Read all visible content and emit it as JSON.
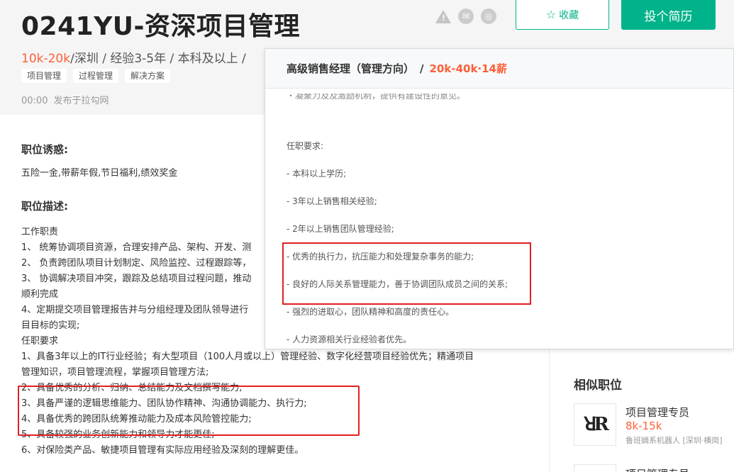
{
  "job": {
    "title": "0241YU-资深项目管理",
    "salary": "10k-20k",
    "meta": "/深圳 / 经验3-5年 / 本科及以上 /",
    "tags": [
      "项目管理",
      "过程管理",
      "解决方案"
    ],
    "publish_time": "00:00",
    "publish_source": "发布于拉勾网"
  },
  "actions": {
    "collect_label": "收藏",
    "apply_label": "投个简历"
  },
  "icons": [
    "warning-icon",
    "wechat-icon",
    "weibo-icon",
    "star-icon"
  ],
  "content": {
    "benefit_title": "职位诱惑:",
    "benefit_text": "五险一金,带薪年假,节日福利,绩效奖金",
    "desc_title": "职位描述:",
    "desc_lines": [
      "工作职责",
      "1、 统筹协调项目资源，合理安排产品、架构、开发、测",
      "2、 负责跨团队项目计划制定、风险监控、过程跟踪等，",
      "3、 协调解决项目冲突，跟踪及总结项目过程问题，推动",
      "顺利完成",
      "4、定期提交项目管理报告并与分组经理及团队领导进行",
      "目目标的实现;",
      "任职要求",
      "1、具备3年以上的IT行业经验；有大型项目（100人月或以上）管理经验、数字化经营项目经验优先；精通项目",
      "管理知识，项目管理流程，掌握项目管理方法;",
      "2、具备优秀的分析、归纳、总结能力及文档撰写能力;",
      "3、具备严谨的逻辑思维能力、团队协作精神、沟通协调能力、执行力;",
      "4、具备优秀的跨团队统筹推动能力及成本风险管控能力;",
      "5、具备较强的业务创新能力和领导力才能更佳;",
      "6、对保险类产品、敏捷项目管理有实际应用经验及深刻的理解更佳。"
    ]
  },
  "popup": {
    "title": "高级销售经理（管理方向）",
    "separator": "/",
    "salary": "20k-40k·14薪",
    "cut_line": "・凝聚力及及激励机制，提供有建设性的意见。",
    "lines": [
      "任职要求:",
      "- 本科以上学历;",
      "- 3年以上销售相关经验;",
      "- 2年以上销售团队管理经验;",
      "- 优秀的执行力，抗压能力和处理复杂事务的能力;",
      "- 良好的人际关系管理能力，善于协调团队成员之间的关系;",
      "- 强烈的进取心，团队精神和高度的责任心。",
      "- 人力资源相关行业经验者优先。"
    ]
  },
  "sidebar": {
    "title": "相似职位",
    "items": [
      {
        "job": "项目管理专员",
        "salary": "8k-15k",
        "company": "鲁班嫡系机器人 [深圳·横岗]",
        "logo_text": "R"
      },
      {
        "job": "项目管理专员"
      }
    ]
  },
  "colors": {
    "accent": "#00b38a",
    "salary": "#fd5f39",
    "highlight_box": "#e02020"
  }
}
